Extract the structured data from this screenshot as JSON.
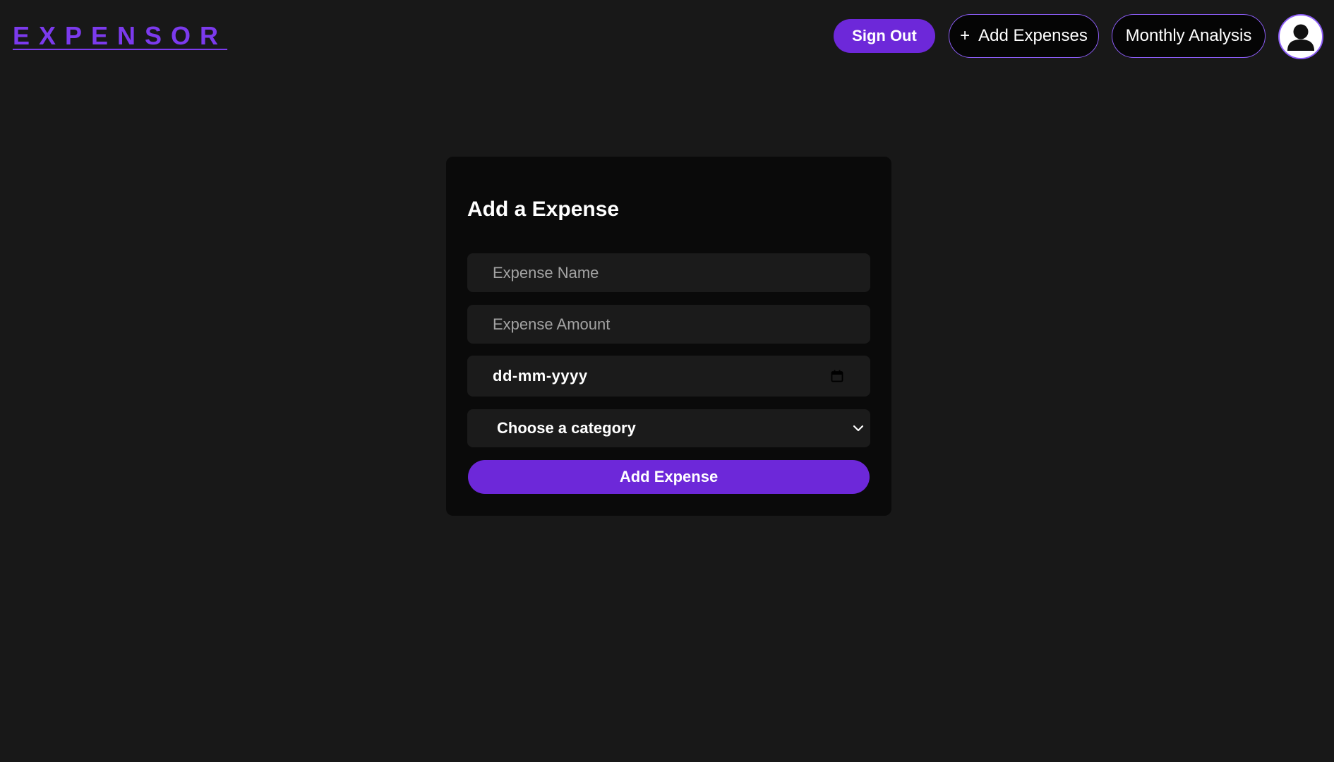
{
  "header": {
    "logo_text": "EXPENSOR",
    "sign_out_label": "Sign Out",
    "add_expenses_label": "Add Expenses",
    "add_expenses_icon": "plus-icon",
    "monthly_analysis_label": "Monthly Analysis",
    "avatar_icon": "user-avatar-icon"
  },
  "form": {
    "title": "Add a Expense",
    "name_placeholder": "Expense Name",
    "name_value": "",
    "amount_placeholder": "Expense Amount",
    "amount_value": "",
    "date_placeholder": "dd-mm-yyyy",
    "date_icon": "calendar-icon",
    "category_selected": "Choose a category",
    "category_icon": "chevron-down-icon",
    "submit_label": "Add Expense"
  },
  "colors": {
    "background": "#181818",
    "card": "#0a0a0a",
    "field": "#1b1b1b",
    "accent": "#6d28d9",
    "accent_border": "#8b5cf6",
    "logo": "#7c3aed"
  }
}
